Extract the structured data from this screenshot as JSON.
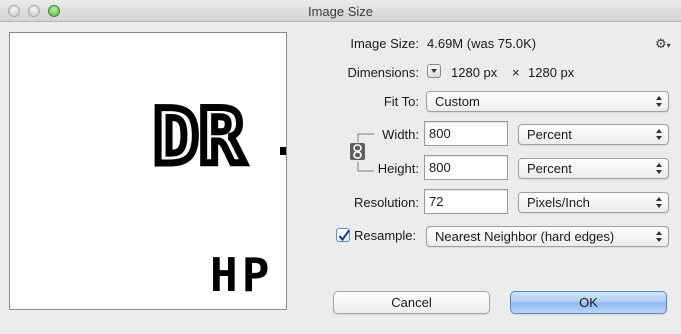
{
  "window": {
    "title": "Image Size"
  },
  "preview": {
    "big_text": "DR",
    "small_text": "HP"
  },
  "image_size": {
    "label": "Image Size:",
    "value": "4.69M (was 75.0K)"
  },
  "dimensions": {
    "label": "Dimensions:",
    "width": "1280 px",
    "times": "×",
    "height": "1280 px"
  },
  "fit_to": {
    "label": "Fit To:",
    "value": "Custom"
  },
  "width": {
    "label": "Width:",
    "value": "800",
    "unit": "Percent"
  },
  "height": {
    "label": "Height:",
    "value": "800",
    "unit": "Percent"
  },
  "resolution": {
    "label": "Resolution:",
    "value": "72",
    "unit": "Pixels/Inch"
  },
  "resample": {
    "label": "Resample:",
    "checked": true,
    "method": "Nearest Neighbor (hard edges)"
  },
  "buttons": {
    "cancel": "Cancel",
    "ok": "OK"
  },
  "colors": {
    "accent": "#8db8f0",
    "window_bg": "#ececec"
  }
}
